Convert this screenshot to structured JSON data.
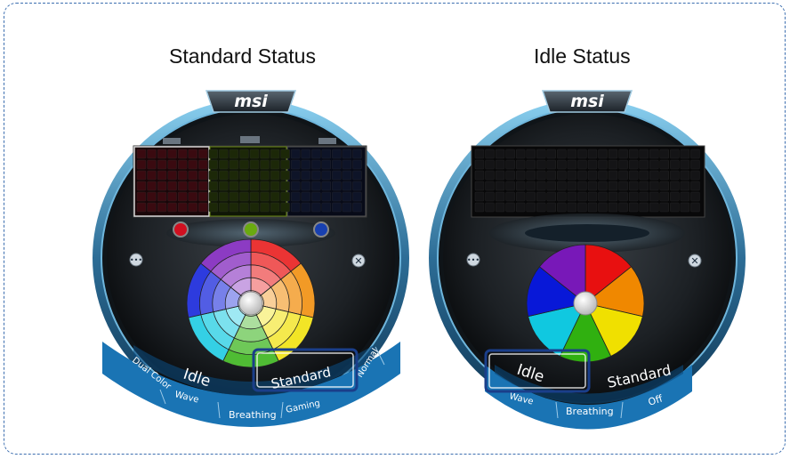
{
  "captions": {
    "left": "Standard Status",
    "right": "Idle Status"
  },
  "panels": {
    "standard": {
      "logo": "msi",
      "menu": {
        "dual_color": "Dual Color",
        "idle": "Idle",
        "standard": "Standard",
        "normal": "Normal",
        "wave": "Wave",
        "breathing": "Breathing",
        "gaming": "Gaming"
      },
      "zone_dots": [
        "#d01020",
        "#6aaa10",
        "#1840b0"
      ],
      "selected_mode": "Standard"
    },
    "idle": {
      "logo": "msi",
      "menu": {
        "idle": "Idle",
        "standard": "Standard",
        "wave": "Wave",
        "breathing": "Breathing",
        "off": "Off"
      },
      "selected_mode": "Idle"
    }
  },
  "colors": {
    "highlight_box": "#1a3e8a",
    "frame": "#3d6fb0",
    "menu_band": "#1a74b4",
    "wheel": [
      "#e81010",
      "#f08800",
      "#f0e000",
      "#30b010",
      "#10c8e0",
      "#0818d8",
      "#7818b8"
    ]
  },
  "icons": {
    "menu": "ellipsis-icon",
    "close": "close-icon",
    "wheel_center": "wheel-center-knob-icon"
  }
}
